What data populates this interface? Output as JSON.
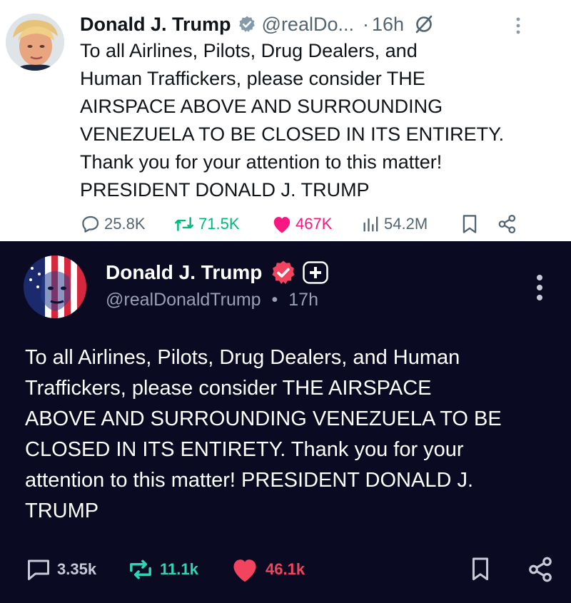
{
  "x_post": {
    "author_name": "Donald J. Trump",
    "handle": "@realDo...",
    "separator": "·",
    "time": "16h",
    "text_lines": [
      "To all Airlines, Pilots, Drug Dealers, and",
      "Human Traffickers, please consider THE",
      "AIRSPACE ABOVE AND SURROUNDING",
      "VENEZUELA TO BE CLOSED IN ITS ENTIRETY.",
      "Thank you for your attention to this matter!",
      "PRESIDENT DONALD J. TRUMP"
    ],
    "stats": {
      "replies": "25.8K",
      "reposts": "71.5K",
      "likes": "467K",
      "views": "54.2M"
    },
    "colors": {
      "background": "#ffffff",
      "text": "#0f1419",
      "muted": "#536471",
      "verified_badge": "#829aab",
      "repost": "#00ba7c",
      "like": "#f91880"
    },
    "icons": [
      "verified-badge-icon",
      "grok-icon",
      "more-vertical-icon",
      "reply-icon",
      "repost-icon",
      "like-icon",
      "views-icon",
      "bookmark-icon",
      "share-icon"
    ]
  },
  "truth_post": {
    "author_name": "Donald J. Trump",
    "handle": "@realDonaldTrump",
    "separator": "•",
    "time": "17h",
    "text_lines": [
      "To all Airlines, Pilots, Drug Dealers, and Human",
      "Traffickers, please consider THE AIRSPACE",
      "ABOVE AND SURROUNDING VENEZUELA TO BE",
      "CLOSED IN ITS ENTIRETY. Thank you for your",
      "attention to this matter! PRESIDENT DONALD J.",
      "TRUMP"
    ],
    "stats": {
      "replies": "3.35k",
      "retruths": "11.1k",
      "likes": "46.1k"
    },
    "colors": {
      "background": "#0a0a22",
      "text": "#ffffff",
      "muted": "#9a9fb8",
      "verified_badge": "#f2445e",
      "retruth": "#2dd4b8",
      "like": "#f2445e"
    },
    "icons": [
      "verified-badge-icon",
      "plus-badge-icon",
      "more-vertical-icon",
      "reply-icon",
      "retruth-icon",
      "like-icon",
      "bookmark-icon",
      "share-icon"
    ]
  }
}
